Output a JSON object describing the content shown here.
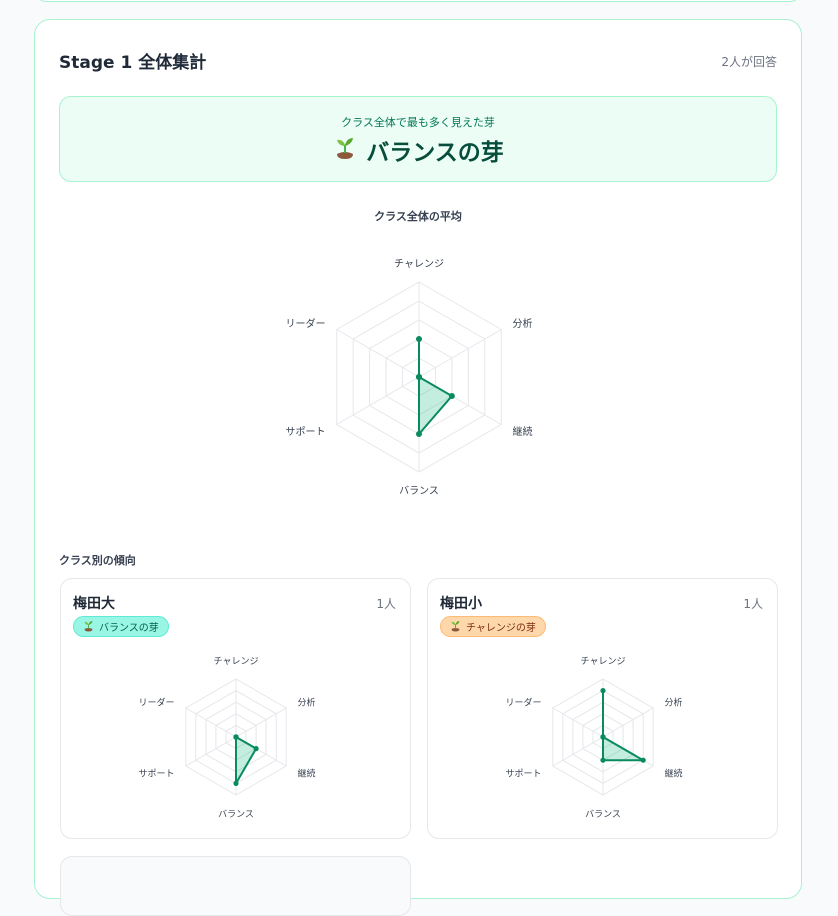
{
  "stage": {
    "title": "Stage 1 全体集計",
    "respondents": "2人が回答"
  },
  "summary": {
    "caption": "クラス全体で最も多く見えた芽",
    "top_sprout": "バランスの芽",
    "icon": "sprout-icon"
  },
  "average": {
    "title": "クラス全体の平均"
  },
  "class_trends": {
    "title": "クラス別の傾向",
    "classes": [
      {
        "name": "梅田大",
        "count": "1人",
        "badge": "バランスの芽",
        "badge_color": "#99f6e4"
      },
      {
        "name": "梅田小",
        "count": "1人",
        "badge": "チャレンジの芽",
        "badge_color": "#fed7aa"
      }
    ]
  },
  "colors": {
    "accent": "#0a8a5f",
    "fill": "rgba(16,185,129,0.25)",
    "grid": "#e5e7eb",
    "card_border": "#a7f3d0"
  },
  "chart_data": [
    {
      "type": "radar",
      "title": "クラス全体の平均",
      "axes": [
        "チャレンジ",
        "分析",
        "継続",
        "バランス",
        "サポート",
        "リーダー"
      ],
      "max": 5,
      "levels": 5,
      "values": [
        2,
        0,
        2,
        3,
        0,
        0
      ]
    },
    {
      "type": "radar",
      "title": "梅田大",
      "axes": [
        "チャレンジ",
        "分析",
        "継続",
        "バランス",
        "サポート",
        "リーダー"
      ],
      "max": 5,
      "levels": 5,
      "values": [
        0,
        0,
        2,
        4,
        0,
        0
      ]
    },
    {
      "type": "radar",
      "title": "梅田小",
      "axes": [
        "チャレンジ",
        "分析",
        "継続",
        "バランス",
        "サポート",
        "リーダー"
      ],
      "max": 5,
      "levels": 5,
      "values": [
        4,
        0,
        4,
        2,
        0,
        0
      ]
    }
  ]
}
